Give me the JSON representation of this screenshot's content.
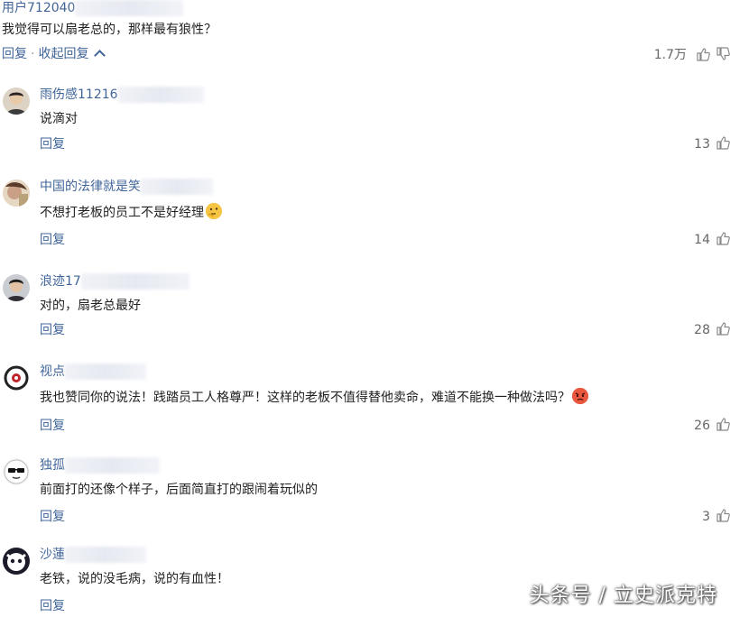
{
  "top_comment": {
    "username": "用户712040",
    "text": "我觉得可以扇老总的，那样最有狼性？",
    "reply_label": "回复",
    "collapse_label": "收起回复",
    "separator": "·",
    "likes": "1.7万"
  },
  "replies": [
    {
      "username": "雨伤感11216",
      "text": "说滴对",
      "reply_label": "回复",
      "likes": "13"
    },
    {
      "username": "中国的法律就是笑",
      "text": "不想打老板的员工不是好经理",
      "emoji": "thinking-face-icon",
      "reply_label": "回复",
      "likes": "14"
    },
    {
      "username": "浪迹17",
      "text": "对的，扇老总最好",
      "reply_label": "回复",
      "likes": "28"
    },
    {
      "username": "视点",
      "text": "我也赞同你的说法！践踏员工人格尊严！这样的老板不值得替他卖命，难道不能换一种做法吗？",
      "emoji": "angry-face-icon",
      "reply_label": "回复",
      "likes": "26"
    },
    {
      "username": "独孤",
      "text": "前面打的还像个样子，后面简直打的跟闹着玩似的",
      "reply_label": "回复",
      "likes": "3"
    },
    {
      "username": "沙蓮",
      "text": "老铁，说的没毛病，说的有血性！",
      "reply_label": "回复",
      "likes": ""
    }
  ],
  "watermark": "头条号 / 立史派克特",
  "colors": {
    "link": "#406599",
    "text": "#222222",
    "muted": "#666666"
  }
}
